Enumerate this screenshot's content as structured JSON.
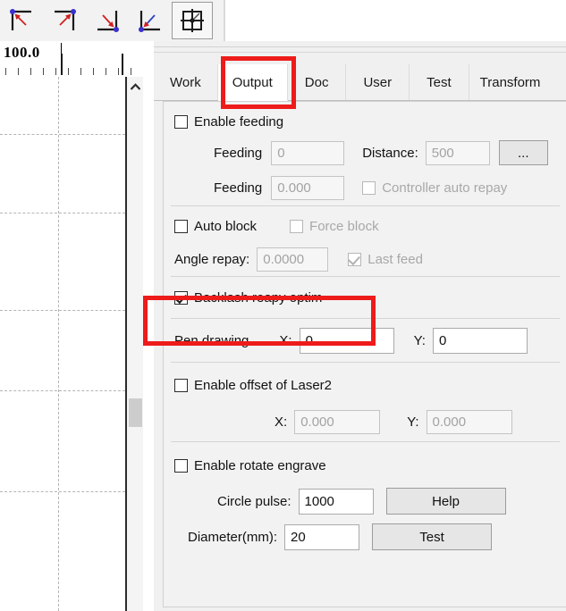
{
  "toolbar": {
    "buttons": [
      {
        "name": "anchor-top-left-icon",
        "label": "Anchor top-left"
      },
      {
        "name": "anchor-top-right-icon",
        "label": "Anchor top-right"
      },
      {
        "name": "anchor-bottom-right-icon",
        "label": "Anchor bottom-right"
      },
      {
        "name": "anchor-bottom-left-icon",
        "label": "Anchor bottom-left"
      },
      {
        "name": "anchor-center-icon",
        "label": "Anchor center"
      }
    ]
  },
  "ruler": {
    "label": "100.0"
  },
  "panel": {
    "tabs": [
      {
        "label": "Work",
        "active": false
      },
      {
        "label": "Output",
        "active": true
      },
      {
        "label": "Doc",
        "active": false
      },
      {
        "label": "User",
        "active": false
      },
      {
        "label": "Test",
        "active": false
      },
      {
        "label": "Transform",
        "active": false
      }
    ],
    "feeding": {
      "enable_label": "Enable feeding",
      "enable_checked": false,
      "feeding_count_label": "Feeding",
      "feeding_count_value": "0",
      "distance_label": "Distance:",
      "distance_value": "500",
      "more_button_label": "...",
      "feeding_delay_label": "Feeding",
      "feeding_delay_value": "0.000",
      "controller_auto_repay_label": "Controller auto repay",
      "controller_auto_repay_checked": false
    },
    "block": {
      "auto_block_label": "Auto block",
      "auto_block_checked": false,
      "force_block_label": "Force block",
      "force_block_checked": false,
      "angle_repay_label": "Angle repay:",
      "angle_repay_value": "0.0000",
      "last_feed_label": "Last feed",
      "last_feed_checked": true
    },
    "backlash": {
      "label": "Backlash reapy optim",
      "checked": true
    },
    "pen_drawing": {
      "label": "Pen drawing",
      "x_label": "X:",
      "x_value": "0",
      "y_label": "Y:",
      "y_value": "0"
    },
    "laser2_offset": {
      "label": "Enable offset of Laser2",
      "checked": false,
      "x_label": "X:",
      "x_value": "0.000",
      "y_label": "Y:",
      "y_value": "0.000"
    },
    "rotate_engrave": {
      "label": "Enable rotate engrave",
      "checked": false,
      "circle_pulse_label": "Circle pulse:",
      "circle_pulse_value": "1000",
      "diameter_label": "Diameter(mm):",
      "diameter_value": "20",
      "help_button_label": "Help",
      "test_button_label": "Test"
    }
  },
  "annotations": {
    "highlight_color": "#ee1b1b",
    "boxes": [
      {
        "target": "tab-output"
      },
      {
        "target": "backlash-reapy-optim-row"
      }
    ]
  }
}
